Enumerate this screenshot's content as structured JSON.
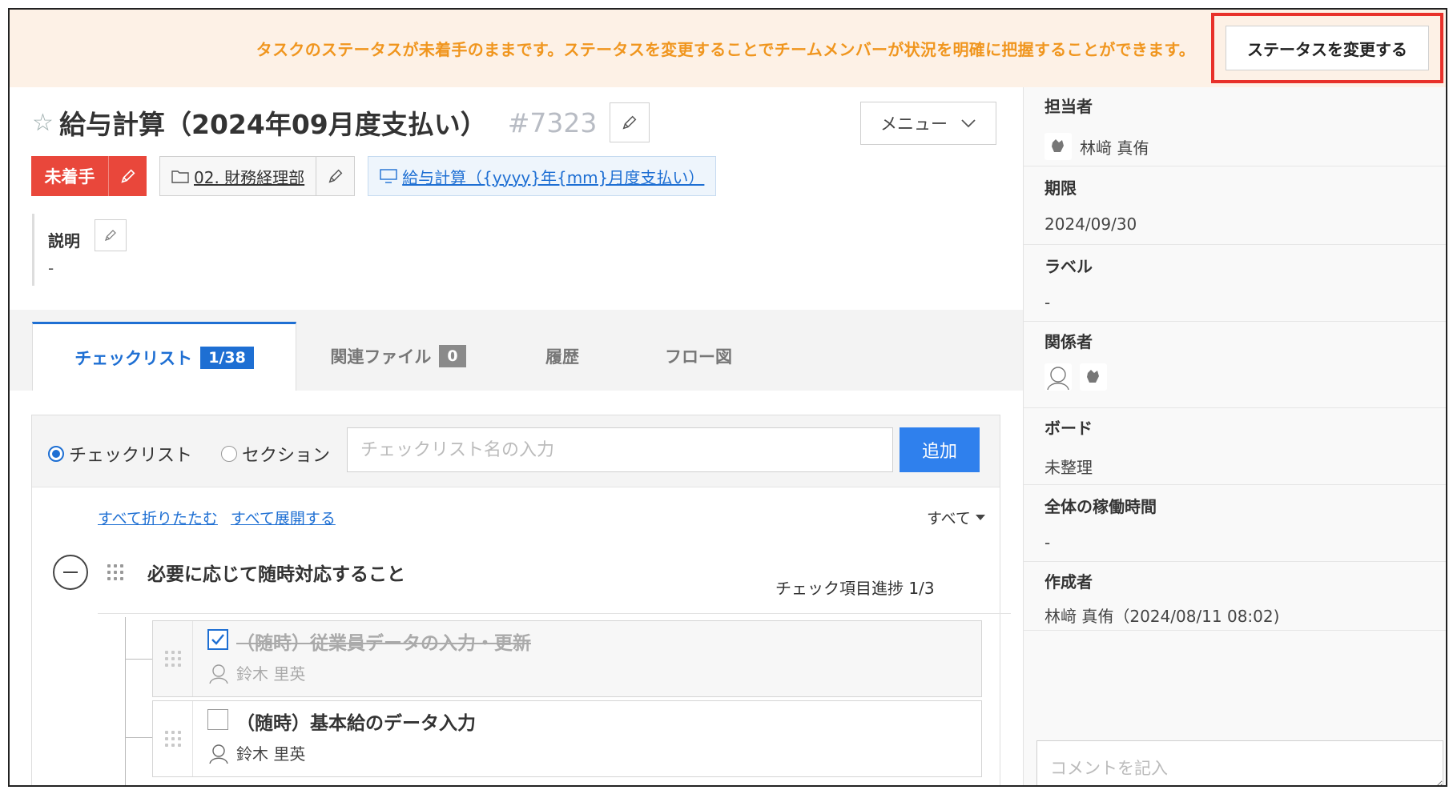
{
  "banner": {
    "message": "タスクのステータスが未着手のままです。ステータスを変更することでチームメンバーが状況を明確に把握することができます。",
    "button_label": "ステータスを変更する",
    "text_color": "#f0961f",
    "highlight_color": "#e8312a"
  },
  "task": {
    "title": "給与計算（2024年09月度支払い）",
    "number": "#7323",
    "menu_label": "メニュー",
    "status": "未着手",
    "status_color": "#e9473b",
    "folder": "02. 財務経理部",
    "template": "給与計算（{yyyy}年{mm}月度支払い）",
    "description_label": "説明",
    "description_value": "-"
  },
  "tabs": [
    {
      "label": "チェックリスト",
      "badge": "1/38",
      "active": true
    },
    {
      "label": "関連ファイル",
      "badge": "0",
      "active": false
    },
    {
      "label": "履歴",
      "active": false
    },
    {
      "label": "フロー図",
      "active": false
    }
  ],
  "checklist": {
    "radio_checklist": "チェックリスト",
    "radio_section": "セクション",
    "input_placeholder": "チェックリスト名の入力",
    "add_label": "追加",
    "collapse_all": "すべて折りたたむ",
    "expand_all": "すべて展開する",
    "filter": "すべて",
    "section_title": "必要に応じて随時対応すること",
    "progress": "チェック項目進捗 1/3",
    "items": [
      {
        "title": "（随時）従業員データの入力・更新",
        "assignee": "鈴木 里英",
        "done": true
      },
      {
        "title": "（随時）基本給のデータ入力",
        "assignee": "鈴木 里英",
        "done": false
      }
    ]
  },
  "sidebar": {
    "assignee_label": "担当者",
    "assignee": "林﨑 真侑",
    "due_label": "期限",
    "due": "2024/09/30",
    "label_label": "ラベル",
    "label_value": "-",
    "stakeholders_label": "関係者",
    "board_label": "ボード",
    "board": "未整理",
    "worktime_label": "全体の稼働時間",
    "worktime": "-",
    "creator_label": "作成者",
    "creator": "林﨑 真侑（2024/08/11 08:02)",
    "comment_placeholder": "コメントを記入"
  },
  "icons": {
    "star": "star-icon",
    "edit": "pencil-icon",
    "folder": "folder-icon",
    "template": "monitor-icon",
    "chevron": "chevron-down-icon"
  },
  "colors": {
    "accent": "#1e6fd3",
    "add_button": "#2f80ed",
    "banner_bg": "#fdf1e6"
  }
}
